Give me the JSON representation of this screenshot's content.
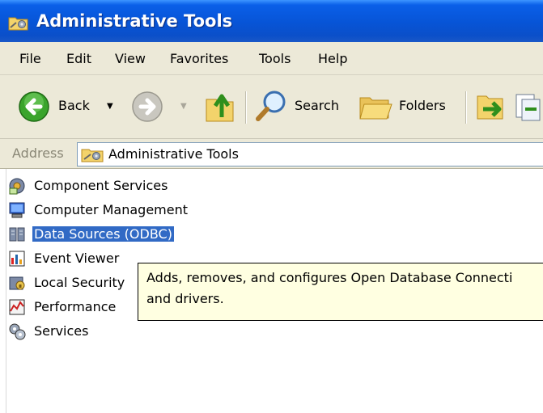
{
  "window": {
    "title": "Administrative Tools",
    "icon": "administrative-tools-folder-icon"
  },
  "menu": {
    "items": [
      {
        "label": "File"
      },
      {
        "label": "Edit"
      },
      {
        "label": "View"
      },
      {
        "label": "Favorites"
      },
      {
        "label": "Tools"
      },
      {
        "label": "Help"
      }
    ]
  },
  "toolbar": {
    "back_label": "Back",
    "search_label": "Search",
    "folders_label": "Folders",
    "back_icon": "back-arrow-icon",
    "forward_icon": "forward-arrow-icon",
    "up_icon": "folder-up-icon",
    "search_icon": "magnifier-icon",
    "folders_icon": "folders-icon",
    "move_to_icon": "move-to-icon",
    "copy_to_icon": "copy-to-icon"
  },
  "address": {
    "label": "Address",
    "value": "Administrative Tools",
    "icon": "administrative-tools-folder-icon"
  },
  "items": [
    {
      "label": "Component Services",
      "icon": "component-services-icon",
      "selected": false
    },
    {
      "label": "Computer Management",
      "icon": "computer-management-icon",
      "selected": false
    },
    {
      "label": "Data Sources (ODBC)",
      "icon": "data-sources-icon",
      "selected": true
    },
    {
      "label": "Event Viewer",
      "icon": "event-viewer-icon",
      "selected": false
    },
    {
      "label": "Local Security",
      "icon": "local-security-icon",
      "selected": false
    },
    {
      "label": "Performance",
      "icon": "performance-icon",
      "selected": false
    },
    {
      "label": "Services",
      "icon": "services-icon",
      "selected": false
    }
  ],
  "tooltip": {
    "line1": "Adds, removes, and configures Open Database Connecti",
    "line2": "and drivers."
  },
  "colors": {
    "titlebar": "#0754d6",
    "chrome": "#ece9d8",
    "selection": "#316ac5",
    "tooltip_bg": "#ffffe1"
  }
}
